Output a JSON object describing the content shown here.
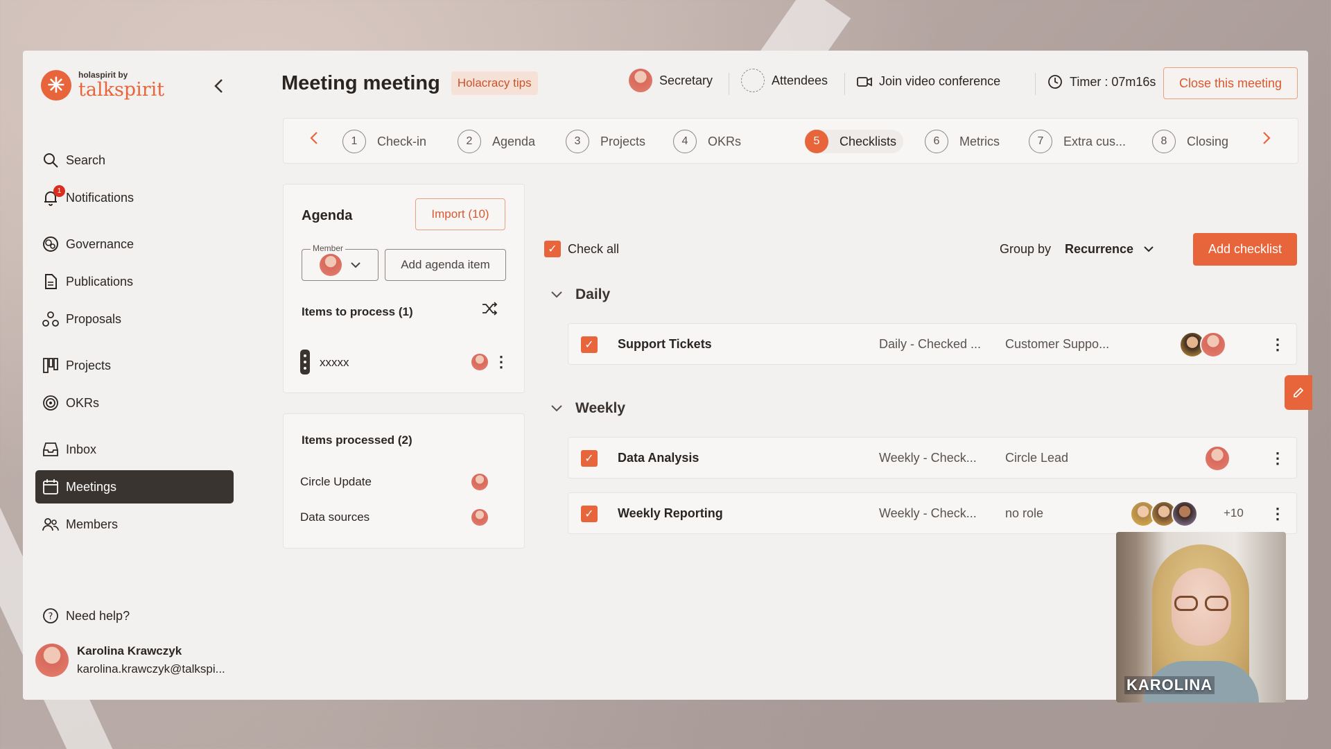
{
  "brand": {
    "small": "holaspirit by",
    "name": "talkspirit"
  },
  "sidebar": {
    "items": [
      {
        "label": "Search",
        "icon": "search-icon"
      },
      {
        "label": "Notifications",
        "icon": "bell-icon",
        "badge": "1"
      },
      {
        "label": "Governance",
        "icon": "governance-icon"
      },
      {
        "label": "Publications",
        "icon": "document-icon"
      },
      {
        "label": "Proposals",
        "icon": "proposals-icon"
      },
      {
        "label": "Projects",
        "icon": "kanban-icon"
      },
      {
        "label": "OKRs",
        "icon": "target-icon"
      },
      {
        "label": "Inbox",
        "icon": "inbox-icon"
      },
      {
        "label": "Meetings",
        "icon": "calendar-icon",
        "active": true
      },
      {
        "label": "Members",
        "icon": "members-icon"
      }
    ],
    "help": "Need help?",
    "user": {
      "name": "Karolina Krawczyk",
      "email": "karolina.krawczyk@talkspi..."
    }
  },
  "header": {
    "title": "Meeting meeting",
    "tips": "Holacracy tips",
    "secretary": "Secretary",
    "attendees": "Attendees",
    "video": "Join video conference",
    "timer": "Timer : 07m16s",
    "close": "Close this meeting"
  },
  "steps": [
    {
      "num": "1",
      "label": "Check-in"
    },
    {
      "num": "2",
      "label": "Agenda"
    },
    {
      "num": "3",
      "label": "Projects"
    },
    {
      "num": "4",
      "label": "OKRs"
    },
    {
      "num": "5",
      "label": "Checklists",
      "active": true
    },
    {
      "num": "6",
      "label": "Metrics"
    },
    {
      "num": "7",
      "label": "Extra cus..."
    },
    {
      "num": "8",
      "label": "Closing"
    }
  ],
  "agenda": {
    "title": "Agenda",
    "import": "Import (10)",
    "member_label": "Member",
    "add_item": "Add agenda item",
    "to_process_title": "Items to process (1)",
    "to_process": [
      {
        "label": "xxxxx"
      }
    ],
    "processed_title": "Items processed (2)",
    "processed": [
      {
        "label": "Circle Update"
      },
      {
        "label": "Data sources"
      }
    ]
  },
  "checklists": {
    "check_all": "Check all",
    "group_by_label": "Group by",
    "group_by_value": "Recurrence",
    "add": "Add checklist",
    "groups": [
      {
        "title": "Daily",
        "items": [
          {
            "name": "Support Tickets",
            "recurrence": "Daily - Checked ...",
            "role": "Customer Suppo...",
            "checked": true
          }
        ]
      },
      {
        "title": "Weekly",
        "items": [
          {
            "name": "Data Analysis",
            "recurrence": "Weekly - Check...",
            "role": "Circle Lead",
            "checked": true
          },
          {
            "name": "Weekly Reporting",
            "recurrence": "Weekly - Check...",
            "role": "no role",
            "checked": true,
            "more": "+10"
          }
        ]
      }
    ]
  },
  "video": {
    "name": "KAROLINA"
  },
  "colors": {
    "accent": "#e8643a",
    "dark": "#3a3430",
    "background": "#f3f1ef"
  }
}
